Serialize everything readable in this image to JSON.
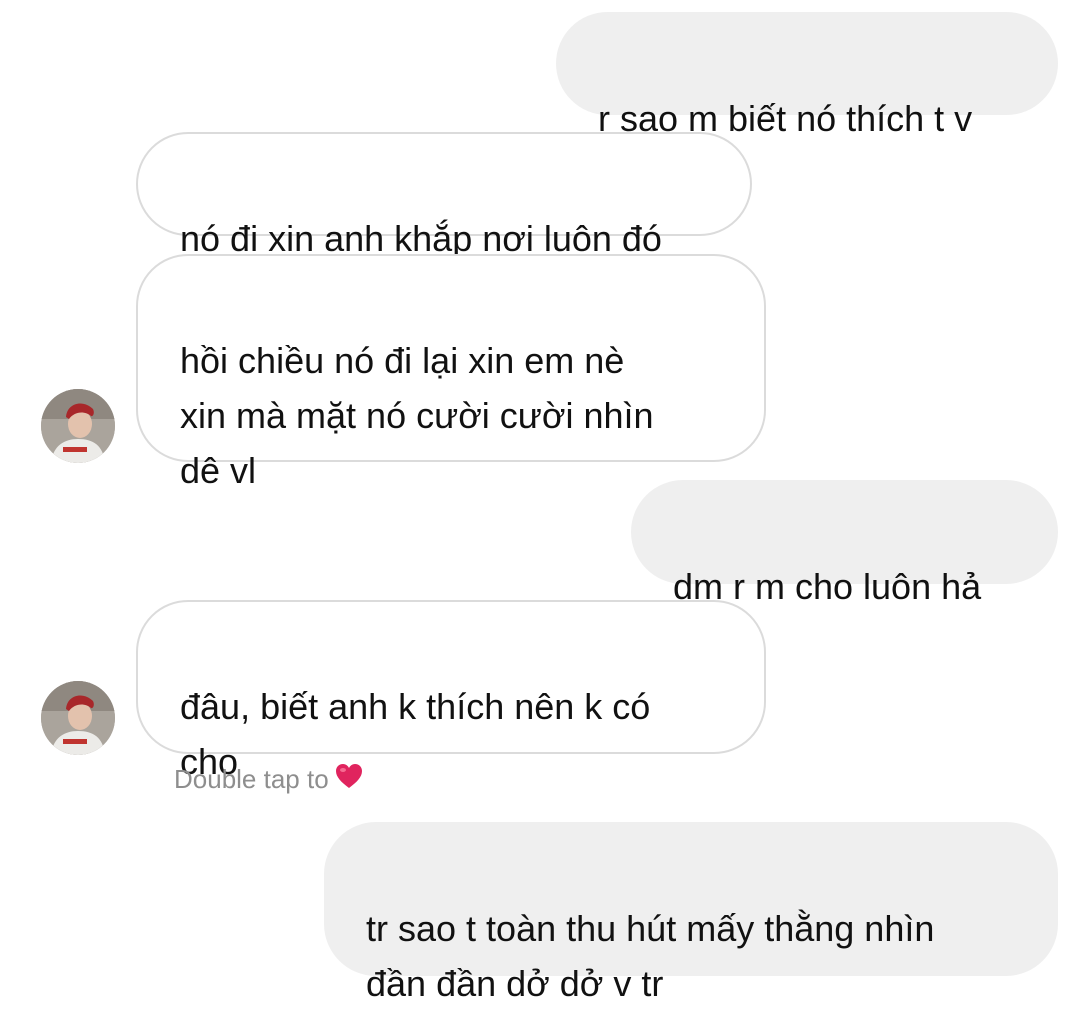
{
  "messages": [
    {
      "id": "m1",
      "side": "sent",
      "text": "r sao m biết nó thích t v"
    },
    {
      "id": "m2",
      "side": "received",
      "text": "nó đi xin anh khắp nơi luôn đó"
    },
    {
      "id": "m3",
      "side": "received",
      "text": "hồi chiều nó đi lại xin em nè\nxin mà mặt nó cười cười nhìn\ndê vl"
    },
    {
      "id": "m4",
      "side": "sent",
      "text": "dm r m cho luôn hả"
    },
    {
      "id": "m5",
      "side": "received",
      "text": "đâu, biết anh k thích nên k có\ncho"
    },
    {
      "id": "m6",
      "side": "sent",
      "text": "tr sao t toàn thu hút mấy thằng nhìn\nđần đần dở dở v tr"
    }
  ],
  "reaction_hint": {
    "text": "Double tap to",
    "icon": "heart-icon",
    "heart_color": "#e0245e"
  },
  "colors": {
    "sent_bubble": "#efefef",
    "received_border": "#dbdbdb",
    "hint_text": "#8e8e8e"
  }
}
